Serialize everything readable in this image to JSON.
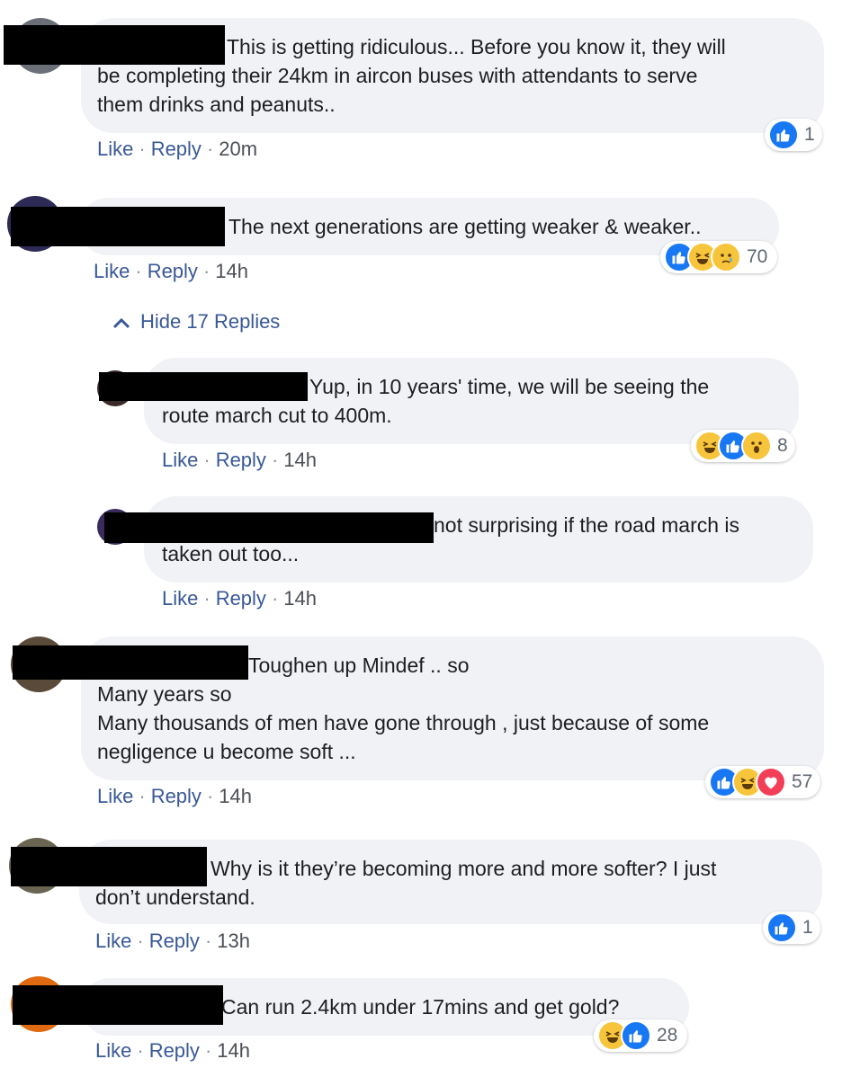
{
  "comments": [
    {
      "lines": [
        "This is getting ridiculous... Before you know it, they will",
        "be completing their 24km in aircon buses with attendants to serve",
        "them drinks and peanuts.."
      ],
      "like": "Like",
      "reply": "Reply",
      "time": "20m",
      "reactions": [
        "like-icon"
      ],
      "reaction_count": "1"
    },
    {
      "lines": [
        "The next generations are getting weaker & weaker.."
      ],
      "like": "Like",
      "reply": "Reply",
      "time": "14h",
      "reactions": [
        "like-icon",
        "haha-icon",
        "sad-icon"
      ],
      "reaction_count": "70"
    },
    {
      "lines": [
        "Yup, in 10 years' time, we will be seeing the",
        "route march cut to 400m."
      ],
      "like": "Like",
      "reply": "Reply",
      "time": "14h",
      "reactions": [
        "haha-icon",
        "like-icon",
        "wow-icon"
      ],
      "reaction_count": "8"
    },
    {
      "lines": [
        "not surprising if the road march is",
        "taken out too..."
      ],
      "like": "Like",
      "reply": "Reply",
      "time": "14h"
    },
    {
      "lines": [
        "Toughen up Mindef .. so",
        "Many years so",
        "Many thousands of men have gone through , just because of some",
        "negligence u become soft ..."
      ],
      "like": "Like",
      "reply": "Reply",
      "time": "14h",
      "reactions": [
        "like-icon",
        "haha-icon",
        "love-icon"
      ],
      "reaction_count": "57"
    },
    {
      "lines": [
        "Why is it they’re becoming more and more softer? I just",
        "don’t understand."
      ],
      "like": "Like",
      "reply": "Reply",
      "time": "13h",
      "reactions": [
        "like-icon"
      ],
      "reaction_count": "1"
    },
    {
      "lines": [
        "Can run 2.4km under 17mins and get gold?"
      ],
      "like": "Like",
      "reply": "Reply",
      "time": "14h",
      "reactions": [
        "haha-icon",
        "like-icon"
      ],
      "reaction_count": "28"
    }
  ],
  "hide_replies": "Hide 17 Replies",
  "colors": {
    "bubble": "#f0f2f5",
    "link": "#385898",
    "like": "#1877f2",
    "haha": "#f7c53b",
    "love": "#f33e58"
  }
}
